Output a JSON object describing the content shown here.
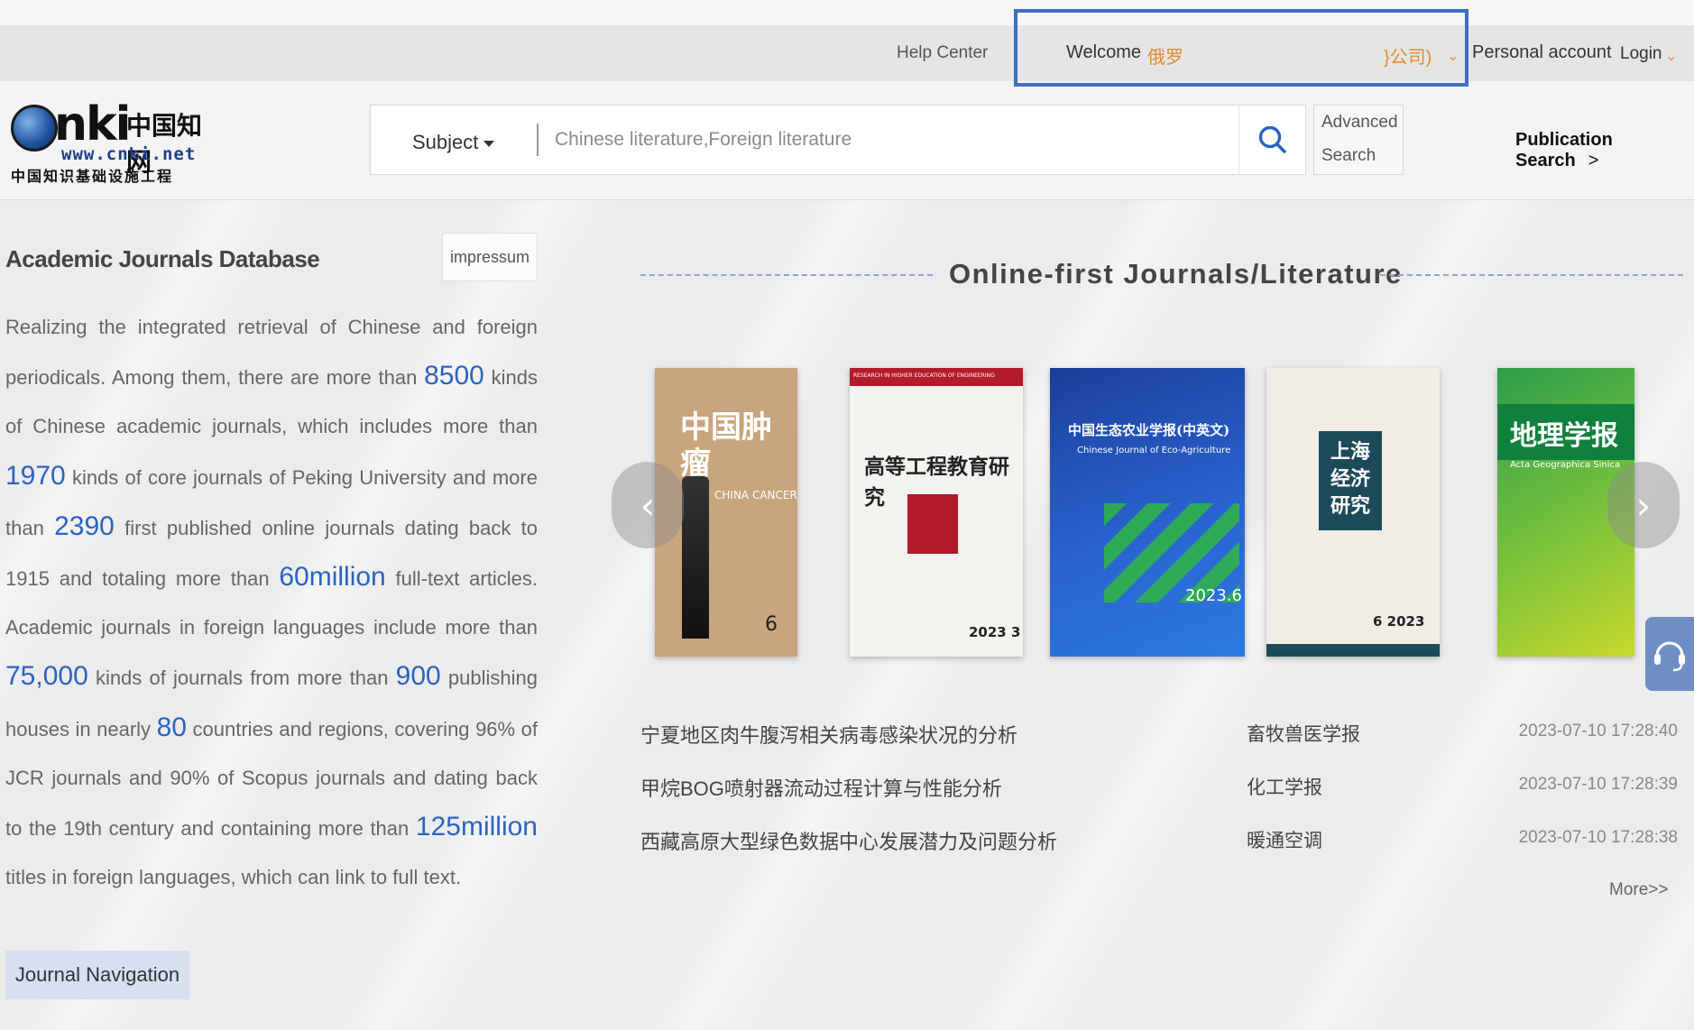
{
  "topbar": {
    "help_center": "Help Center",
    "welcome_label": "Welcome",
    "welcome_name": "俄罗",
    "welcome_org": "}公司)",
    "personal_account": "Personal account",
    "login": "Login"
  },
  "header": {
    "logo_main": "nki",
    "logo_cn": "中国知网",
    "logo_url": "www.cnki.net",
    "logo_sub": "中国知识基础设施工程",
    "subject_label": "Subject",
    "search_placeholder": "Chinese literature,Foreign literature",
    "advanced_search_line1": "Advanced",
    "advanced_search_line2": "Search",
    "publication_search": "Publication Search",
    "publication_search_arrow": ">"
  },
  "left": {
    "title": "Academic Journals Database",
    "impressum": "impressum",
    "desc": {
      "p1": "Realizing the integrated retrieval of Chinese and foreign periodicals. Among them, there are more than",
      "n1": "8500",
      "p2": "kinds of Chinese academic journals, which includes more than",
      "n2": "1970",
      "p3": "kinds of core journals of Peking University and more than",
      "n3": "2390",
      "p4": "first published online journals dating back to 1915 and totaling more than",
      "n4": "60million",
      "p5": "full-text articles. Academic journals in foreign languages include more than",
      "n5": "75,000",
      "p6": "kinds of journals from more than",
      "n6": "900",
      "p7": "publishing houses in nearly",
      "n7": "80",
      "p8": "countries and regions, covering 96% of JCR journals and 90% of Scopus journals and dating back to the 19th century and containing more than",
      "n8": "125million",
      "p9": "titles in foreign languages, which can link to full text."
    },
    "journal_navigation": "Journal Navigation"
  },
  "right": {
    "section_title": "Online-first Journals/Literature",
    "covers": [
      {
        "title": "中国肿瘤",
        "subtitle": "CHINA CANCER",
        "issue": "6",
        "bg": "#c9a57e"
      },
      {
        "title": "高等工程教育研究",
        "subtitle": "RESEARCH IN HIGHER EDUCATION OF ENGINEERING",
        "issue": "2023 3",
        "bg": "#f4f2ef"
      },
      {
        "title": "中国生态农业学报(中英文)",
        "subtitle": "Chinese Journal of Eco-Agriculture",
        "issue": "2023.6",
        "bg": "#1e4fb8"
      },
      {
        "title": "上海经济研究",
        "subtitle": "",
        "issue": "6 2023",
        "bg": "#f1ece4"
      },
      {
        "title": "地理学报",
        "subtitle": "Acta Geographica Sinica",
        "issue": "",
        "bg": "#3aa53c"
      }
    ],
    "prev_arrow": "‹",
    "next_arrow": "›",
    "articles": [
      {
        "title": "宁夏地区肉牛腹泻相关病毒感染状况的分析",
        "journal": "畜牧兽医学报",
        "date": "2023-07-10 17:28:40"
      },
      {
        "title": "甲烷BOG喷射器流动过程计算与性能分析",
        "journal": "化工学报",
        "date": "2023-07-10 17:28:39"
      },
      {
        "title": "西藏高原大型绿色数据中心发展潜力及问题分析",
        "journal": "暖通空调",
        "date": "2023-07-10 17:28:38"
      }
    ],
    "more": "More>>"
  },
  "colors": {
    "accent_blue": "#2b63c2",
    "highlight_border": "#3f6fbe",
    "orange": "#e48a2a"
  }
}
